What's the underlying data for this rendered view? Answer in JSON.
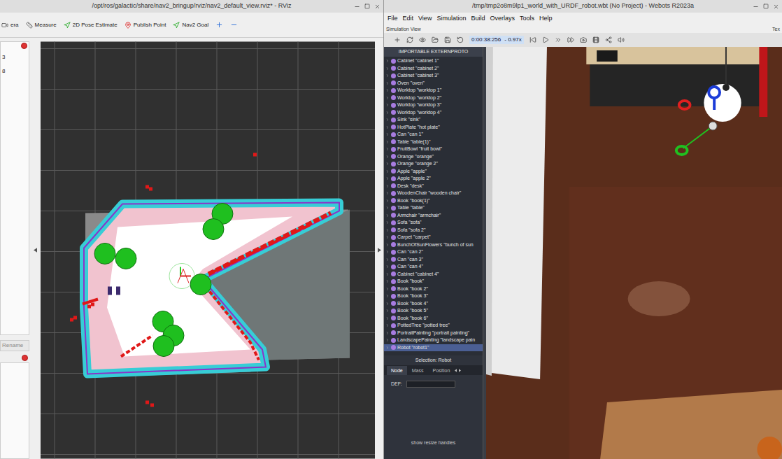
{
  "rviz": {
    "title": "/opt/ros/galactic/share/nav2_bringup/rviz/nav2_default_view.rviz* - RViz",
    "tools": [
      {
        "label": "era",
        "kind": "camera"
      },
      {
        "label": "Measure",
        "kind": "measure"
      },
      {
        "label": "2D Pose Estimate",
        "kind": "pose"
      },
      {
        "label": "Publish Point",
        "kind": "point"
      },
      {
        "label": "Nav2 Goal",
        "kind": "goal"
      }
    ],
    "side_panel": {
      "values": [
        "3",
        "8"
      ],
      "button": "Rename"
    }
  },
  "webots": {
    "title": "/tmp/tmp2o8m9lp1_world_with_URDF_robot.wbt (No Project) - Webots R2023a",
    "menu": [
      "File",
      "Edit",
      "View",
      "Simulation",
      "Build",
      "Overlays",
      "Tools",
      "Help"
    ],
    "view_label": "Simulation View",
    "side_label": "Tex",
    "time": "0:00:38:256",
    "speed": "- 0.97x",
    "tree_header": "IMPORTABLE EXTERNPROTO",
    "tree": [
      {
        "label": "Cabinet \"cabinet 1\"",
        "selected": false
      },
      {
        "label": "Cabinet \"cabinet 2\"",
        "selected": false
      },
      {
        "label": "Cabinet \"cabinet 3\"",
        "selected": false
      },
      {
        "label": "Oven \"oven\"",
        "selected": false
      },
      {
        "label": "Worktop \"worktop 1\"",
        "selected": false
      },
      {
        "label": "Worktop \"worktop 2\"",
        "selected": false
      },
      {
        "label": "Worktop \"worktop 3\"",
        "selected": false
      },
      {
        "label": "Worktop \"worktop 4\"",
        "selected": false
      },
      {
        "label": "Sink \"sink\"",
        "selected": false
      },
      {
        "label": "HotPlate \"hot plate\"",
        "selected": false
      },
      {
        "label": "Can \"can 1\"",
        "selected": false
      },
      {
        "label": "Table \"table(1)\"",
        "selected": false
      },
      {
        "label": "FruitBowl \"fruit bowl\"",
        "selected": false
      },
      {
        "label": "Orange \"orange\"",
        "selected": false
      },
      {
        "label": "Orange \"orange 2\"",
        "selected": false
      },
      {
        "label": "Apple \"apple\"",
        "selected": false
      },
      {
        "label": "Apple \"apple 2\"",
        "selected": false
      },
      {
        "label": "Desk \"desk\"",
        "selected": false
      },
      {
        "label": "WoodenChair \"wooden chair\"",
        "selected": false
      },
      {
        "label": "Book \"book(1)\"",
        "selected": false
      },
      {
        "label": "Table \"table\"",
        "selected": false
      },
      {
        "label": "Armchair \"armchair\"",
        "selected": false
      },
      {
        "label": "Sofa \"sofa\"",
        "selected": false
      },
      {
        "label": "Sofa \"sofa 2\"",
        "selected": false
      },
      {
        "label": "Carpet \"carpet\"",
        "selected": false
      },
      {
        "label": "BunchOfSunFlowers \"bunch of sun",
        "selected": false
      },
      {
        "label": "Can \"can 2\"",
        "selected": false
      },
      {
        "label": "Can \"can 3\"",
        "selected": false
      },
      {
        "label": "Can \"can 4\"",
        "selected": false
      },
      {
        "label": "Cabinet \"cabinet 4\"",
        "selected": false
      },
      {
        "label": "Book \"book\"",
        "selected": false
      },
      {
        "label": "Book \"book 2\"",
        "selected": false
      },
      {
        "label": "Book \"book 3\"",
        "selected": false
      },
      {
        "label": "Book \"book 4\"",
        "selected": false
      },
      {
        "label": "Book \"book 5\"",
        "selected": false
      },
      {
        "label": "Book \"book 6\"",
        "selected": false
      },
      {
        "label": "PottedTree \"potted tree\"",
        "selected": false
      },
      {
        "label": "PortraitPainting \"portrait painting\"",
        "selected": false
      },
      {
        "label": "LandscapePainting \"landscape pain",
        "selected": false
      },
      {
        "label": "Robot \"robot1\"",
        "selected": true
      }
    ],
    "selection": {
      "title": "Selection: Robot",
      "tabs": [
        {
          "label": "Node",
          "selected": true
        },
        {
          "label": "Mass",
          "selected": false
        },
        {
          "label": "Position",
          "selected": false
        }
      ],
      "def_label": "DEF:",
      "link": "show resize handles"
    }
  }
}
